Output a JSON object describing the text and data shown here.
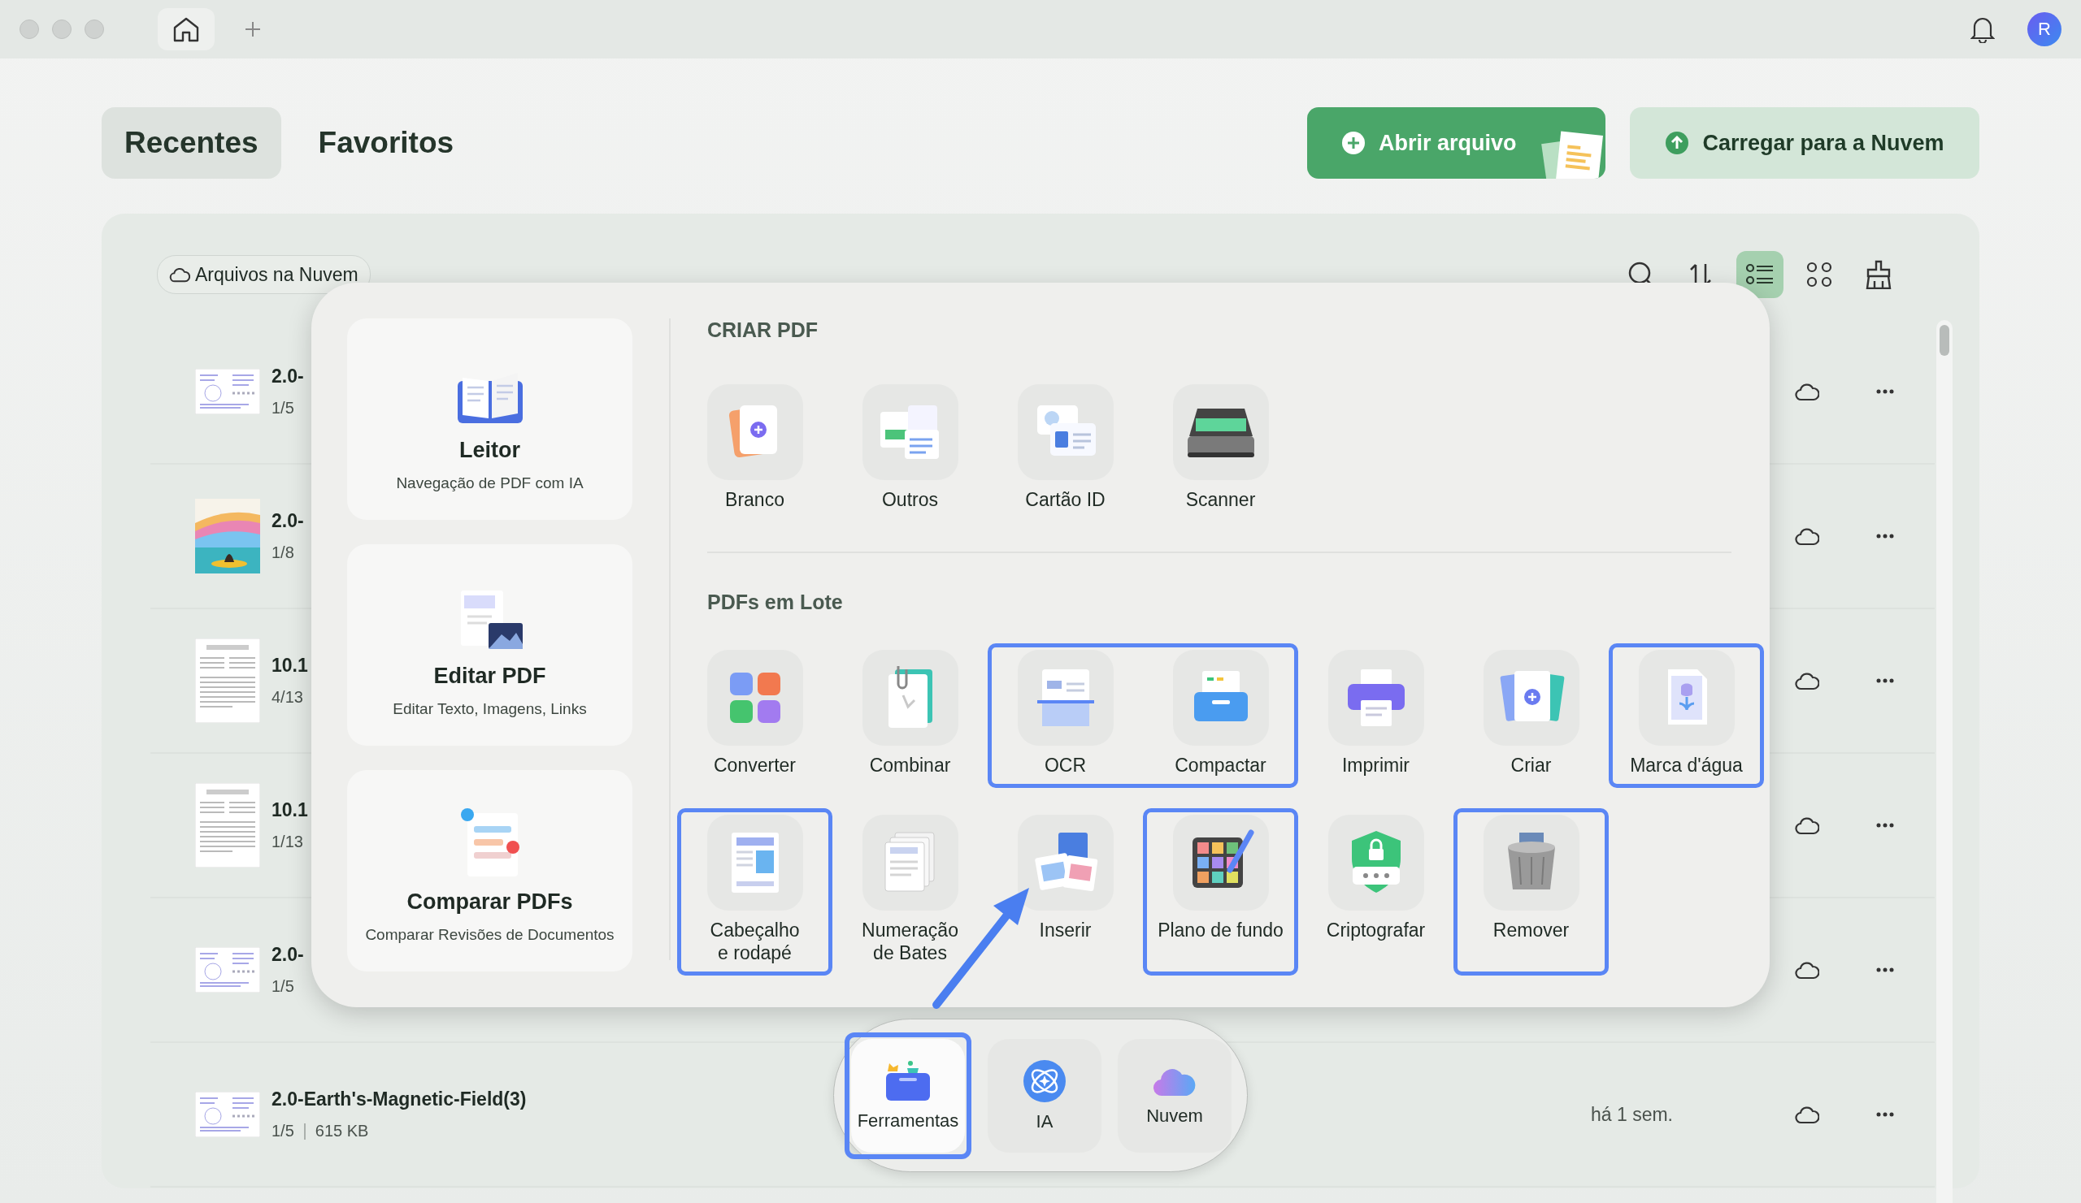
{
  "window": {
    "avatar_initial": "R"
  },
  "tabs": [
    {
      "label": "Recentes",
      "selected": true
    },
    {
      "label": "Favoritos",
      "selected": false
    }
  ],
  "actions": [
    {
      "label": "Abrir arquivo",
      "kind": "primary"
    },
    {
      "label": "Carregar para a Nuvem",
      "kind": "secondary"
    }
  ],
  "filter_chip": "Arquivos na Nuvem",
  "toolbar": [
    {
      "selected": false
    },
    {
      "selected": false
    },
    {
      "selected": true
    },
    {
      "selected": false
    },
    {
      "selected": false
    }
  ],
  "files": [
    {
      "name": "2.0-",
      "pages": "1/5",
      "kind": "slide"
    },
    {
      "name": "2.0-",
      "pages": "1/8"
    },
    {
      "name": "10.1",
      "pages": "4/13",
      "kind": "article"
    },
    {
      "name": "10.1",
      "pages": "1/13",
      "kind": "article"
    },
    {
      "name": "2.0-",
      "pages": "1/5",
      "kind": "slide"
    },
    {
      "name": "2.0-Earth's-Magnetic-Field(3)",
      "pages": "1/5",
      "size": "615 KB",
      "modified": "há 1 sem.",
      "kind": "slide"
    }
  ],
  "feature_cards": [
    {
      "title": "Leitor",
      "subtitle": "Navegação de PDF com IA"
    },
    {
      "title": "Editar PDF",
      "subtitle": "Editar Texto, Imagens, Links"
    },
    {
      "title": "Comparar PDFs",
      "subtitle": "Comparar Revisões de Documentos"
    }
  ],
  "create_pdf": {
    "title": "CRIAR PDF",
    "tools": [
      {
        "label": "Branco",
        "highlighted": false
      },
      {
        "label": "Outros",
        "highlighted": false
      },
      {
        "label": "Cartão ID",
        "highlighted": false
      },
      {
        "label": "Scanner",
        "highlighted": false
      }
    ]
  },
  "batch_pdfs": {
    "title": "PDFs em Lote",
    "rows": [
      [
        {
          "label": "Converter",
          "highlighted": false
        },
        {
          "label": "Combinar",
          "highlighted": false
        },
        {
          "label": "OCR",
          "highlighted": true
        },
        {
          "label": "Compactar",
          "highlighted": true
        },
        {
          "label": "Imprimir",
          "highlighted": false
        },
        {
          "label": "Criar",
          "highlighted": false
        },
        {
          "label": "Marca d'água",
          "highlighted": true
        }
      ],
      [
        {
          "label": "Cabeçalho\ne rodapé",
          "highlighted": true
        },
        {
          "label": "Numeração\nde Bates",
          "highlighted": false
        },
        {
          "label": "Inserir",
          "highlighted": false
        },
        {
          "label": "Plano de fundo",
          "highlighted": true
        },
        {
          "label": "Criptografar",
          "highlighted": false
        },
        {
          "label": "Remover",
          "highlighted": true
        }
      ]
    ]
  },
  "dock": [
    {
      "label": "Ferramentas",
      "selected": true,
      "highlighted": true
    },
    {
      "label": "IA",
      "selected": false,
      "highlighted": false
    },
    {
      "label": "Nuvem",
      "selected": false,
      "highlighted": false
    }
  ]
}
